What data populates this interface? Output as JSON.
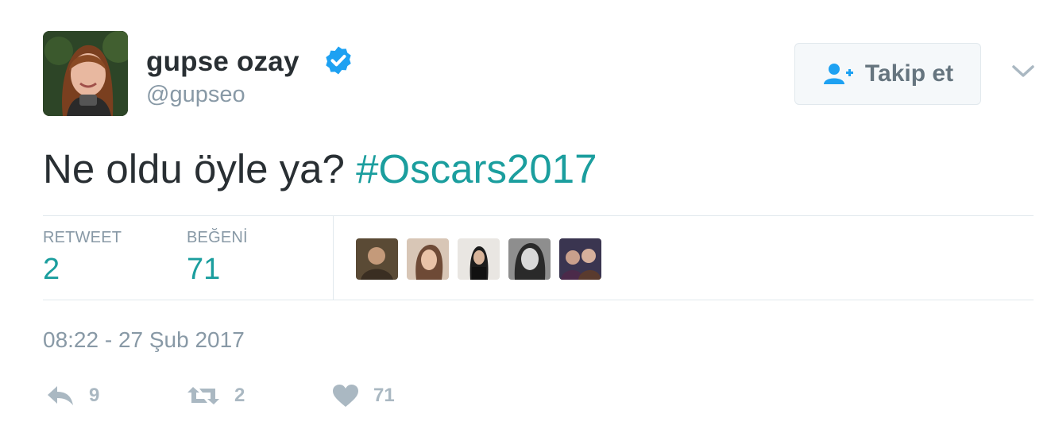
{
  "user": {
    "name": "gupse ozay",
    "handle": "@gupseo",
    "verified": true
  },
  "follow_button": {
    "label": "Takip et",
    "icon": "follow-person-plus-icon"
  },
  "tweet": {
    "text": "Ne oldu öyle ya? ",
    "hashtag": "#Oscars2017"
  },
  "stats": {
    "retweet_label": "RETWEET",
    "retweet_count": "2",
    "like_label": "BEĞENİ",
    "like_count": "71"
  },
  "timestamp": "08:22 - 27 Şub 2017",
  "actions": {
    "reply_count": "9",
    "retweet_count": "2",
    "like_count": "71"
  },
  "colors": {
    "hashtag": "#1b9e9e",
    "verified": "#1da1f2",
    "muted": "#8899a6",
    "follow_icon": "#1da1f2"
  }
}
